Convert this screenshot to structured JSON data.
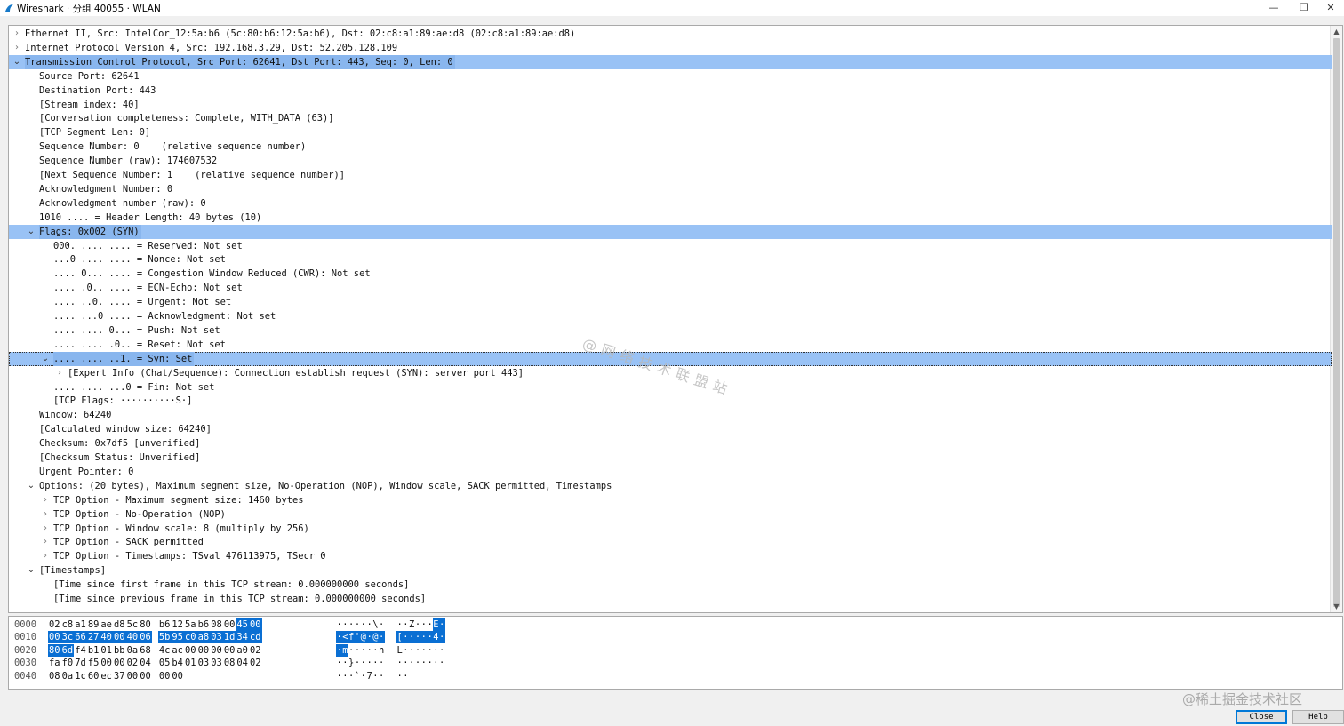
{
  "window": {
    "title": "Wireshark · 分组 40055 · WLAN",
    "controls": {
      "minimize": "—",
      "restore": "❐",
      "close": "✕"
    }
  },
  "tree": [
    {
      "indent": 0,
      "expander": "closed",
      "text": "Ethernet II, Src: IntelCor_12:5a:b6 (5c:80:b6:12:5a:b6), Dst: 02:c8:a1:89:ae:d8 (02:c8:a1:89:ae:d8)"
    },
    {
      "indent": 0,
      "expander": "closed",
      "text": "Internet Protocol Version 4, Src: 192.168.3.29, Dst: 52.205.128.109"
    },
    {
      "indent": 0,
      "expander": "open",
      "text": "Transmission Control Protocol, Src Port: 62641, Dst Port: 443, Seq: 0, Len: 0",
      "selected": true
    },
    {
      "indent": 1,
      "expander": "none",
      "text": "Source Port: 62641"
    },
    {
      "indent": 1,
      "expander": "none",
      "text": "Destination Port: 443"
    },
    {
      "indent": 1,
      "expander": "none",
      "text": "[Stream index: 40]"
    },
    {
      "indent": 1,
      "expander": "none",
      "text": "[Conversation completeness: Complete, WITH_DATA (63)]"
    },
    {
      "indent": 1,
      "expander": "none",
      "text": "[TCP Segment Len: 0]"
    },
    {
      "indent": 1,
      "expander": "none",
      "text": "Sequence Number: 0    (relative sequence number)"
    },
    {
      "indent": 1,
      "expander": "none",
      "text": "Sequence Number (raw): 174607532"
    },
    {
      "indent": 1,
      "expander": "none",
      "text": "[Next Sequence Number: 1    (relative sequence number)]"
    },
    {
      "indent": 1,
      "expander": "none",
      "text": "Acknowledgment Number: 0"
    },
    {
      "indent": 1,
      "expander": "none",
      "text": "Acknowledgment number (raw): 0"
    },
    {
      "indent": 1,
      "expander": "none",
      "text": "1010 .... = Header Length: 40 bytes (10)"
    },
    {
      "indent": 1,
      "expander": "open",
      "text": "Flags: 0x002 (SYN)",
      "selected": true
    },
    {
      "indent": 2,
      "expander": "none",
      "text": "000. .... .... = Reserved: Not set"
    },
    {
      "indent": 2,
      "expander": "none",
      "text": "...0 .... .... = Nonce: Not set"
    },
    {
      "indent": 2,
      "expander": "none",
      "text": ".... 0... .... = Congestion Window Reduced (CWR): Not set"
    },
    {
      "indent": 2,
      "expander": "none",
      "text": ".... .0.. .... = ECN-Echo: Not set"
    },
    {
      "indent": 2,
      "expander": "none",
      "text": ".... ..0. .... = Urgent: Not set"
    },
    {
      "indent": 2,
      "expander": "none",
      "text": ".... ...0 .... = Acknowledgment: Not set"
    },
    {
      "indent": 2,
      "expander": "none",
      "text": ".... .... 0... = Push: Not set"
    },
    {
      "indent": 2,
      "expander": "none",
      "text": ".... .... .0.. = Reset: Not set"
    },
    {
      "indent": 2,
      "expander": "open",
      "text": ".... .... ..1. = Syn: Set",
      "selected": true,
      "focus": true
    },
    {
      "indent": 3,
      "expander": "closed",
      "text": "[Expert Info (Chat/Sequence): Connection establish request (SYN): server port 443]"
    },
    {
      "indent": 2,
      "expander": "none",
      "text": ".... .... ...0 = Fin: Not set"
    },
    {
      "indent": 2,
      "expander": "none",
      "text": "[TCP Flags: ··········S·]"
    },
    {
      "indent": 1,
      "expander": "none",
      "text": "Window: 64240"
    },
    {
      "indent": 1,
      "expander": "none",
      "text": "[Calculated window size: 64240]"
    },
    {
      "indent": 1,
      "expander": "none",
      "text": "Checksum: 0x7df5 [unverified]"
    },
    {
      "indent": 1,
      "expander": "none",
      "text": "[Checksum Status: Unverified]"
    },
    {
      "indent": 1,
      "expander": "none",
      "text": "Urgent Pointer: 0"
    },
    {
      "indent": 1,
      "expander": "open",
      "text": "Options: (20 bytes), Maximum segment size, No-Operation (NOP), Window scale, SACK permitted, Timestamps"
    },
    {
      "indent": 2,
      "expander": "closed",
      "text": "TCP Option - Maximum segment size: 1460 bytes"
    },
    {
      "indent": 2,
      "expander": "closed",
      "text": "TCP Option - No-Operation (NOP)"
    },
    {
      "indent": 2,
      "expander": "closed",
      "text": "TCP Option - Window scale: 8 (multiply by 256)"
    },
    {
      "indent": 2,
      "expander": "closed",
      "text": "TCP Option - SACK permitted"
    },
    {
      "indent": 2,
      "expander": "closed",
      "text": "TCP Option - Timestamps: TSval 476113975, TSecr 0"
    },
    {
      "indent": 1,
      "expander": "open",
      "text": "[Timestamps]"
    },
    {
      "indent": 2,
      "expander": "none",
      "text": "[Time since first frame in this TCP stream: 0.000000000 seconds]"
    },
    {
      "indent": 2,
      "expander": "none",
      "text": "[Time since previous frame in this TCP stream: 0.000000000 seconds]"
    }
  ],
  "bytes": [
    {
      "offset": "0000",
      "hex": [
        "02",
        "c8",
        "a1",
        "89",
        "ae",
        "d8",
        "5c",
        "80",
        "b6",
        "12",
        "5a",
        "b6",
        "08",
        "00",
        "45",
        "00"
      ],
      "ascii": "······\\·  ··Z···E·",
      "hl": [
        14,
        15
      ]
    },
    {
      "offset": "0010",
      "hex": [
        "00",
        "3c",
        "66",
        "27",
        "40",
        "00",
        "40",
        "06",
        "5b",
        "95",
        "c0",
        "a8",
        "03",
        "1d",
        "34",
        "cd"
      ],
      "ascii": "·<f'@·@·  [·····4·",
      "hl": [
        0,
        1,
        2,
        3,
        4,
        5,
        6,
        7,
        8,
        9,
        10,
        11,
        12,
        13,
        14,
        15
      ]
    },
    {
      "offset": "0020",
      "hex": [
        "80",
        "6d",
        "f4",
        "b1",
        "01",
        "bb",
        "0a",
        "68",
        "4c",
        "ac",
        "00",
        "00",
        "00",
        "00",
        "a0",
        "02"
      ],
      "ascii": "·m·····h  L·······",
      "hl": [
        0,
        1
      ]
    },
    {
      "offset": "0030",
      "hex": [
        "fa",
        "f0",
        "7d",
        "f5",
        "00",
        "00",
        "02",
        "04",
        "05",
        "b4",
        "01",
        "03",
        "03",
        "08",
        "04",
        "02"
      ],
      "ascii": "··}·····  ········",
      "hl": []
    },
    {
      "offset": "0040",
      "hex": [
        "08",
        "0a",
        "1c",
        "60",
        "ec",
        "37",
        "00",
        "00",
        "00",
        "00"
      ],
      "ascii": "···`·7··  ··",
      "hl": []
    }
  ],
  "watermark": "@网络技术联盟站",
  "juejin": "@稀土掘金技术社区",
  "buttons": {
    "close": "Close",
    "help": "Help"
  },
  "colors": {
    "selection": "#99c2f5",
    "byte_highlight": "#0a6fd3"
  }
}
